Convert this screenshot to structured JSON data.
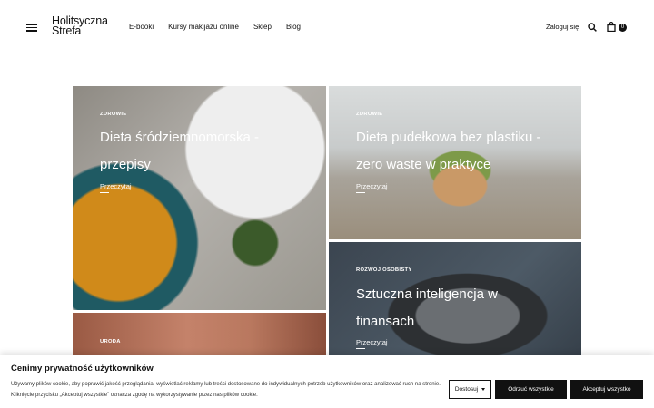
{
  "header": {
    "logo_line1": "Holitsyczna",
    "logo_line2": "Strefa",
    "nav": [
      "E-booki",
      "Kursy makijażu online",
      "Sklep",
      "Blog"
    ],
    "login": "Zaloguj się",
    "cart_count": "0"
  },
  "cards": [
    {
      "category": "ZDROWIE",
      "title_line1": "Dieta śródziemnomorska -",
      "title_line2": "przepisy",
      "more": "Przeczytaj"
    },
    {
      "category": "ZDROWIE",
      "title_line1": "Dieta pudełkowa bez plastiku -",
      "title_line2": "zero waste w praktyce",
      "more": "Przeczytaj"
    },
    {
      "category": "ROZWÓJ OSOBISTY",
      "title_line1": "Sztuczna inteligencja w",
      "title_line2": "finansach",
      "more": "Przeczytaj"
    },
    {
      "category": "URODA"
    }
  ],
  "cookie": {
    "title": "Cenimy prywatność użytkowników",
    "text": "Używamy plików cookie, aby poprawić jakość przeglądania, wyświetlać reklamy lub treści dostosowane do indywidualnych potrzeb użytkowników oraz analizować ruch na stronie. Kliknięcie przycisku „Akceptuj wszystkie” oznacza zgodę na wykorzystywanie przez nas plików cookie.",
    "customize": "Dostosuj",
    "reject": "Odrzuć wszystkie",
    "accept": "Akceptuj wszystko"
  }
}
